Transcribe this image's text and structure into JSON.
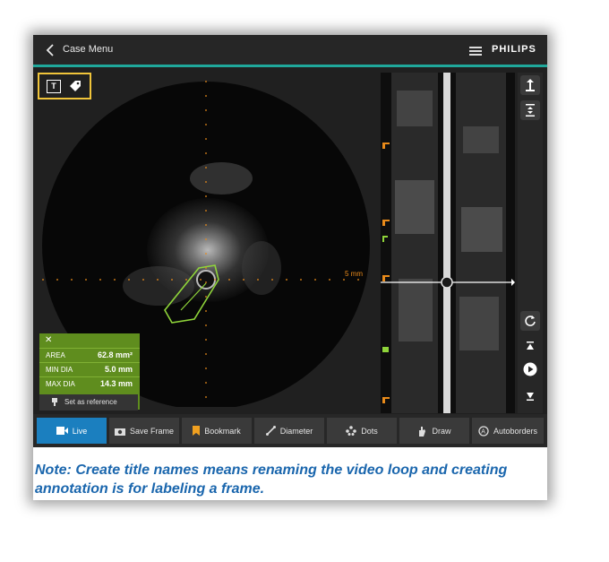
{
  "header": {
    "back_label": "Case Menu",
    "brand": "PHILIPS"
  },
  "annotation_tools": {
    "title_tool_glyph": "T",
    "tools": [
      "title-icon",
      "tag-icon"
    ]
  },
  "ivus": {
    "scale_label": "5 mm"
  },
  "measurements": {
    "rows": [
      {
        "label": "AREA",
        "value": "62.8 mm²"
      },
      {
        "label": "MIN DIA",
        "value": "5.0 mm"
      },
      {
        "label": "MAX DIA",
        "value": "14.3 mm"
      }
    ],
    "set_reference": "Set as reference"
  },
  "toolbar": {
    "live": "Live",
    "save_frame": "Save Frame",
    "bookmark": "Bookmark",
    "diameter": "Diameter",
    "dots": "Dots",
    "draw": "Draw",
    "autoborders": "Autoborders"
  },
  "note": "Note: Create title names means renaming the video loop and creating annotation is for labeling a frame.",
  "colors": {
    "accent": "#1fa89b",
    "highlight": "#f0c43a",
    "measure": "#5f8d1e",
    "live": "#1b7fbf",
    "note": "#1a66ad",
    "marker": "#e88a1a"
  }
}
